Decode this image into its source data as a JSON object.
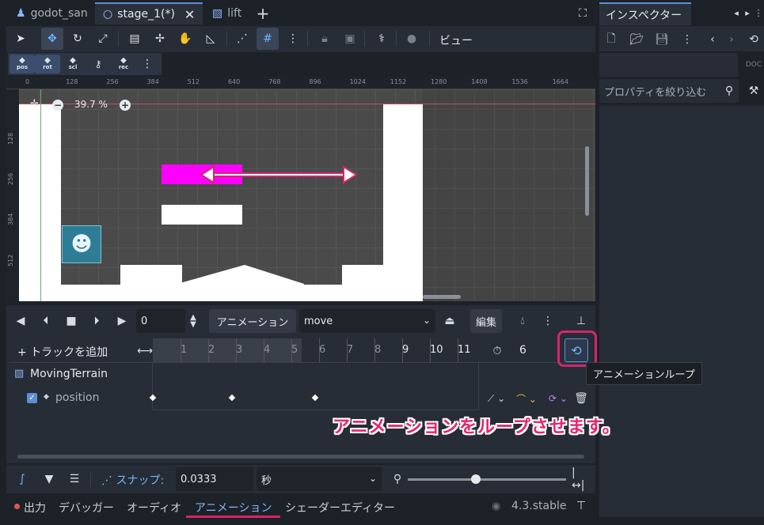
{
  "tabs": [
    {
      "label": "godot_san",
      "icon": "person-icon"
    },
    {
      "label": "stage_1(*)",
      "icon": "circle-icon",
      "active": true
    },
    {
      "label": "lift",
      "icon": "scene-icon"
    }
  ],
  "toolbar": {
    "view_label": "ビュー"
  },
  "sub_tools": [
    "pos",
    "rot",
    "scl",
    "",
    "rec"
  ],
  "ruler": {
    "top": [
      "0",
      "128",
      "256",
      "384",
      "512",
      "640",
      "768",
      "896",
      "1024",
      "1152",
      "1280",
      "1408",
      "1536",
      "1664"
    ],
    "left": [
      "128",
      "256",
      "384",
      "512"
    ]
  },
  "zoom": {
    "label": "39.7 %"
  },
  "anim": {
    "frame_value": "0",
    "animation_label": "アニメーション",
    "animation_name": "move",
    "edit_label": "編集",
    "add_track_label": "トラックを追加",
    "ticks": [
      "1",
      "2",
      "3",
      "4",
      "5",
      "6",
      "7",
      "8",
      "9",
      "10",
      "11"
    ],
    "length_value": "6",
    "node_name": "MovingTerrain",
    "track_name": "position",
    "loop_tooltip": "アニメーションループ"
  },
  "bottom": {
    "snap_label": "スナップ:",
    "snap_value": "0.0333",
    "unit": "秒",
    "zoom_fraction": 0.5
  },
  "bottom_tabs": [
    "出力",
    "デバッガー",
    "オーディオ",
    "アニメーション",
    "シェーダーエディター"
  ],
  "version": "4.3.stable",
  "inspector": {
    "title": "インスペクター",
    "filter_placeholder": "プロパティを絞り込む"
  },
  "annotation": "アニメーションをループさせます。",
  "colors": {
    "accent": "#d6246e",
    "magenta_block": "#ff00ff",
    "selected_tool": "#6fb6ff"
  }
}
